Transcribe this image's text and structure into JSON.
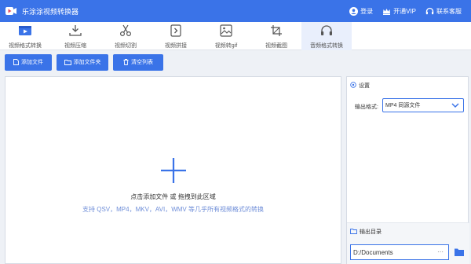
{
  "app": {
    "title": "乐涂涂视频转换器"
  },
  "titlebar": {
    "login": "登录",
    "vip": "开通VIP",
    "service": "联系客服"
  },
  "tabs": [
    {
      "label": "视频格式转换",
      "icon": "video-convert-icon"
    },
    {
      "label": "视频压缩",
      "icon": "compress-icon"
    },
    {
      "label": "视频切割",
      "icon": "scissors-icon"
    },
    {
      "label": "视频拼接",
      "icon": "merge-icon"
    },
    {
      "label": "视频转gif",
      "icon": "gif-icon"
    },
    {
      "label": "视频截图",
      "icon": "crop-icon"
    },
    {
      "label": "音频格式转换",
      "icon": "headphones-icon",
      "active": true
    }
  ],
  "toolbar": {
    "add_file": "添加文件",
    "add_folder": "添加文件夹",
    "clear_list": "清空列表"
  },
  "droparea": {
    "title": "点击添加文件 或 拖拽到此区域",
    "hint": "支持 QSV，MP4，MKV，AVI，WMV 等几乎所有视频格式的转换"
  },
  "settings": {
    "heading": "设置",
    "format_label": "输出格式:",
    "format_value": "MP4 同源文件"
  },
  "output": {
    "heading": "输出目录",
    "path": "D:/Documents",
    "dots": "⋯"
  },
  "colors": {
    "accent": "#3a73e8",
    "hint": "#6f8ed8"
  }
}
